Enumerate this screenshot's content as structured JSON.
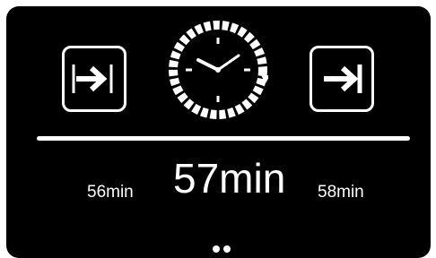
{
  "colors": {
    "background": "#000000",
    "foreground": "#ffffff"
  },
  "icons": {
    "prev": "arrow-to-bar-icon",
    "next": "arrow-to-bar-icon",
    "clock": "clock-icon"
  },
  "time_picker": {
    "previous": "56min",
    "current": "57min",
    "next": "58min"
  },
  "pager": {
    "pages": 2
  }
}
